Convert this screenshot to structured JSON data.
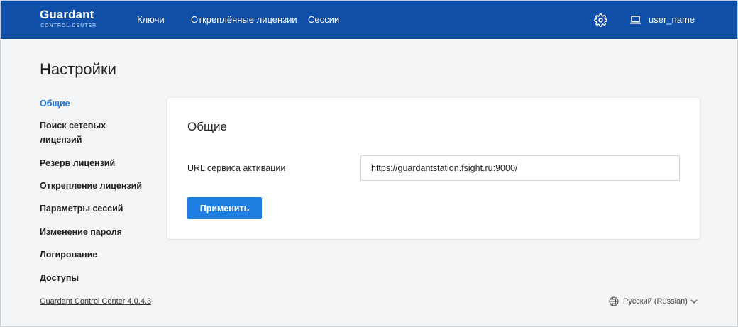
{
  "header": {
    "logo_name": "Guardant",
    "logo_sub": "CONTROL CENTER",
    "nav": [
      {
        "label": "Ключи"
      },
      {
        "label": "Откреплённые лицензии"
      },
      {
        "label": "Сессии"
      }
    ],
    "settings_icon": "gear-icon",
    "user_icon": "laptop-icon",
    "user_name": "user_name"
  },
  "page": {
    "title": "Настройки"
  },
  "sidebar": {
    "items": [
      {
        "label": "Общие",
        "active": true
      },
      {
        "label": "Поиск сетевых"
      },
      {
        "label": "лицензий"
      },
      {
        "label": "Резерв лицензий"
      },
      {
        "label": "Открепление лицензий"
      },
      {
        "label": "Параметры сессий"
      },
      {
        "label": "Изменение пароля"
      },
      {
        "label": "Логирование"
      },
      {
        "label": "Доступы"
      }
    ]
  },
  "card": {
    "title": "Общие",
    "field_label": "URL сервиса активации",
    "field_value": "https://guardantstation.fsight.ru:9000/",
    "apply_label": "Применить"
  },
  "footer": {
    "version": "Guardant Control Center 4.0.4.3",
    "language": "Русский (Russian)",
    "language_icon": "globe-icon"
  },
  "colors": {
    "header_bg": "#0f4fa8",
    "accent": "#1e7de0",
    "active_link": "#1976d2",
    "page_bg": "#f4f5f6"
  }
}
